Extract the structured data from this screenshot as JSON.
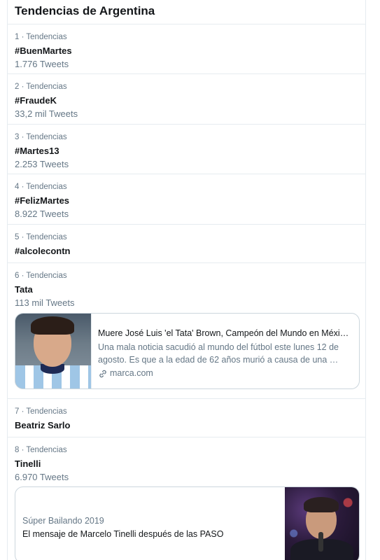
{
  "header": {
    "title": "Tendencias de Argentina"
  },
  "trends": [
    {
      "meta": "1 · Tendencias",
      "name": "#BuenMartes",
      "count": "1.776 Tweets"
    },
    {
      "meta": "2 · Tendencias",
      "name": "#FraudeK",
      "count": "33,2 mil Tweets"
    },
    {
      "meta": "3 · Tendencias",
      "name": "#Martes13",
      "count": "2.253 Tweets"
    },
    {
      "meta": "4 · Tendencias",
      "name": "#FelizMartes",
      "count": "8.922 Tweets"
    },
    {
      "meta": "5 · Tendencias",
      "name": "#alcolecontn"
    },
    {
      "meta": "6 · Tendencias",
      "name": "Tata",
      "count": "113 mil Tweets"
    },
    {
      "meta": "7 · Tendencias",
      "name": "Beatriz Sarlo"
    },
    {
      "meta": "8 · Tendencias",
      "name": "Tinelli",
      "count": "6.970 Tweets"
    }
  ],
  "news_card": {
    "headline": "Muere José Luis 'el Tata' Brown, Campeón del Mundo en Méxi…",
    "description": "Una mala noticia sacudió al mundo del fútbol este lunes 12 de agosto. Es que a la edad de 62 años murió a causa de una …",
    "source": "marca.com",
    "icon": "link-icon"
  },
  "show_card": {
    "category": "Súper Bailando 2019",
    "title": "El mensaje de Marcelo Tinelli después de las PASO"
  },
  "colors": {
    "text_primary": "#14171a",
    "text_secondary": "#657786",
    "border": "#e6ecf0"
  }
}
